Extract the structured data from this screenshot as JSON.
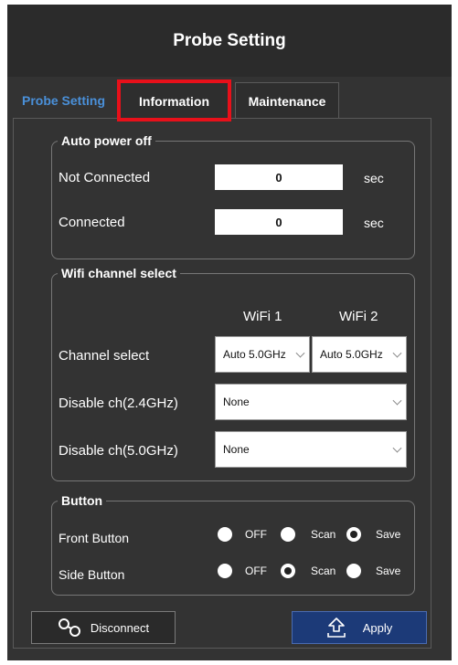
{
  "window": {
    "title": "Probe Setting"
  },
  "tabs": [
    {
      "label": "Probe Setting",
      "active": true
    },
    {
      "label": "Information",
      "highlighted": true
    },
    {
      "label": "Maintenance"
    }
  ],
  "auto_power": {
    "legend": "Auto power off",
    "not_connected": {
      "label": "Not Connected",
      "value": "0",
      "unit": "sec"
    },
    "connected": {
      "label": "Connected",
      "value": "0",
      "unit": "sec"
    }
  },
  "wifi": {
    "legend": "Wifi channel select",
    "col1": "WiFi 1",
    "col2": "WiFi 2",
    "channel_select": {
      "label": "Channel select",
      "wifi1": "Auto 5.0GHz",
      "wifi2": "Auto 5.0GHz"
    },
    "disable_24": {
      "label": "Disable ch(2.4GHz)",
      "value": "None"
    },
    "disable_50": {
      "label": "Disable ch(5.0GHz)",
      "value": "None"
    }
  },
  "button_group": {
    "legend": "Button",
    "options": [
      "OFF",
      "Scan",
      "Save"
    ],
    "front": {
      "label": "Front Button",
      "selected": "Save"
    },
    "side": {
      "label": "Side Button",
      "selected": "Scan"
    }
  },
  "actions": {
    "disconnect": "Disconnect",
    "apply": "Apply"
  },
  "colors": {
    "accent_tab": "#4a90d9",
    "highlight": "#e8101a",
    "apply_bg": "#1c3a78"
  }
}
